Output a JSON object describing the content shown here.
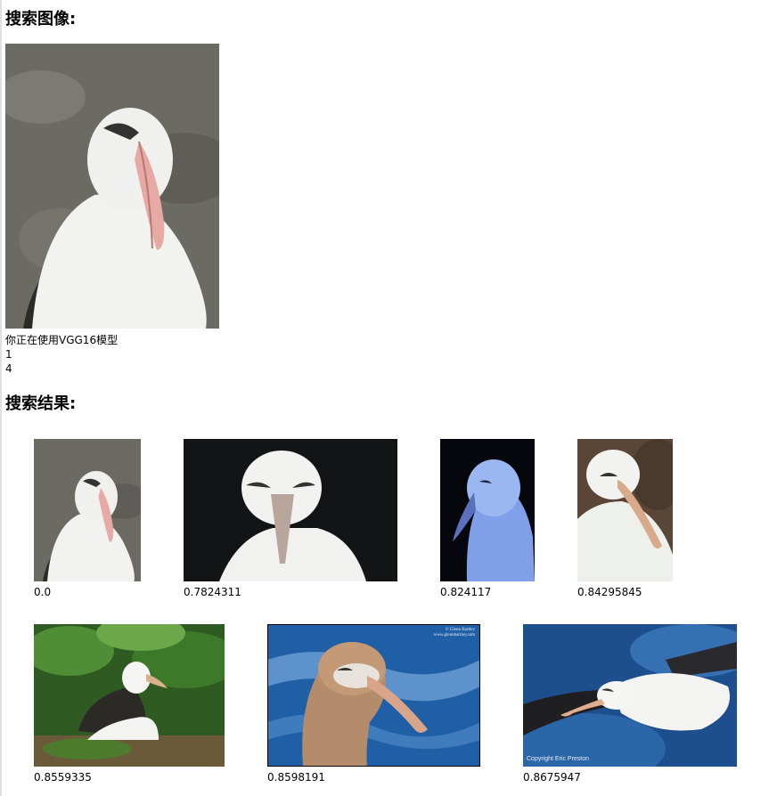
{
  "query": {
    "heading": "搜索图像:",
    "model_note": "你正在使用VGG16模型",
    "line1": "1",
    "line2": "4",
    "image": {
      "kind": "albatross-grey-bg"
    }
  },
  "results": {
    "heading": "搜索结果:",
    "items": [
      {
        "score": "0.0",
        "kind": "albatross-grey-bg"
      },
      {
        "score": "0.7824311",
        "kind": "albatross-dark-front"
      },
      {
        "score": "0.824117",
        "kind": "albatross-blue-tint"
      },
      {
        "score": "0.84295845",
        "kind": "albatross-brown-bg"
      },
      {
        "score": "0.8559335",
        "kind": "albatross-nest-green"
      },
      {
        "score": "0.8598191",
        "kind": "albatross-brown-ocean",
        "watermark": "© Glenn Bartley\nwww.glennbartley.com"
      },
      {
        "score": "0.8675947",
        "kind": "albatross-flight",
        "watermark": "Copyright Eric Preston"
      }
    ]
  }
}
